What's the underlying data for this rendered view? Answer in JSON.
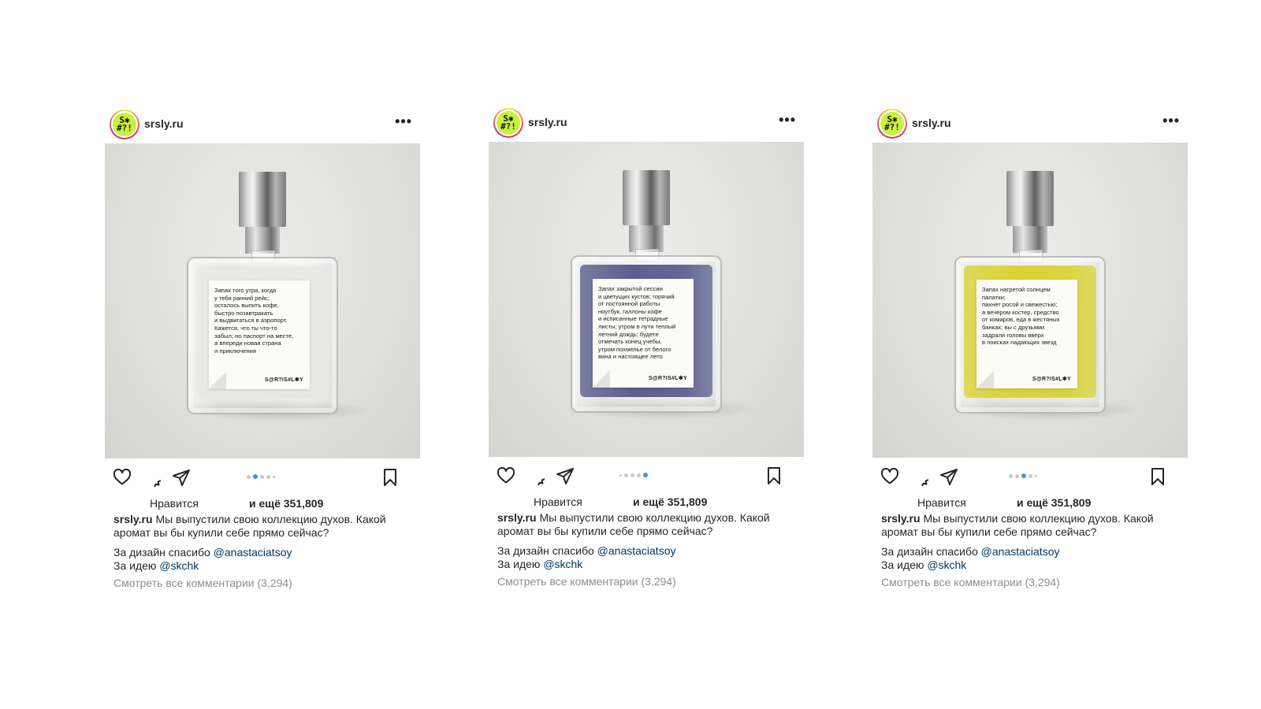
{
  "posts": [
    {
      "username": "srsly.ru",
      "avatar_lines": [
        "S✱",
        "#?!"
      ],
      "more_label": "•••",
      "bottle": {
        "liquid_color": "#e8e8e6",
        "label_text": "Запах того утра, когда\nу тебя ранний рейс;\nосталось выпить кофе,\nбыстро позавтракать\nи выдвигаться в аэропорт.\nКажется, что ты что-то\nзабыл; но паспорт на месте,\nа впереди новая страна\nи приключения",
        "label_brand": "S@R?IS#L✱Y"
      },
      "carousel": {
        "count": 5,
        "active": 1
      },
      "likes_label": "Нравится",
      "likes_count": "и ещё 351,809",
      "caption_user": "srsly.ru",
      "caption_text": "Мы выпустили свою коллекцию духов. Какой аромат вы бы купили себе прямо сейчас?",
      "credit1_text": "За дизайн спасибо",
      "credit1_mention": "@anastaciatsoy",
      "credit2_text": "За идею",
      "credit2_mention": "@skchk",
      "comments_link": "Смотреть все комментарии (3,294)"
    },
    {
      "username": "srsly.ru",
      "avatar_lines": [
        "S✱",
        "#?!"
      ],
      "more_label": "•••",
      "bottle": {
        "liquid_color": "#5b5f8f",
        "label_text": "Запах закрытой сессии\nи цветущих кустов; горячий\nот постоянной работы\nноутбук, галлоны кофе\nи исписанные тетрадные\nлисты; утром в пути теплый\nлетний дождь; будете\nотмечать конец учебы,\nутром похмелье от белого\nвина и настоящее лето",
        "label_brand": "S@R?IS#L✱Y"
      },
      "carousel": {
        "count": 5,
        "active": 4
      },
      "likes_label": "Нравится",
      "likes_count": "и ещё 351,809",
      "caption_user": "srsly.ru",
      "caption_text": "Мы выпустили свою коллекцию духов. Какой аромат вы бы купили себе прямо сейчас?",
      "credit1_text": "За дизайн спасибо",
      "credit1_mention": "@anastaciatsoy",
      "credit2_text": "За идею",
      "credit2_mention": "@skchk",
      "comments_link": "Смотреть все комментарии (3,294)"
    },
    {
      "username": "srsly.ru",
      "avatar_lines": [
        "S✱",
        "#?!"
      ],
      "more_label": "•••",
      "bottle": {
        "liquid_color": "#d9d335",
        "label_text": "Запах нагретой солнцем\nпалатки;\nпахнет росой и свежестью;\nа вечером костер, средство\nот комаров, еда в жестяных\nбанках; вы с друзьями\nзадрали головы вверх\nв поисках падающих звезд",
        "label_brand": "S@R?IS#L✱Y"
      },
      "carousel": {
        "count": 5,
        "active": 2
      },
      "likes_label": "Нравится",
      "likes_count": "и ещё 351,809",
      "caption_user": "srsly.ru",
      "caption_text": "Мы выпустили свою коллекцию духов. Какой аромат вы бы купили себе прямо сейчас?",
      "credit1_text": "За дизайн спасибо",
      "credit1_mention": "@anastaciatsoy",
      "credit2_text": "За идею",
      "credit2_mention": "@skchk",
      "comments_link": "Смотреть все комментарии (3,294)"
    }
  ],
  "colors": {
    "accent_blue": "#3897f0",
    "mention": "#00376b",
    "muted_text": "#8e8e8e",
    "avatar_green": "#c9f23d"
  },
  "icons": [
    "like-heart-icon",
    "comment-bubble-icon",
    "share-paper-plane-icon",
    "bookmark-icon",
    "more-dots-icon"
  ]
}
